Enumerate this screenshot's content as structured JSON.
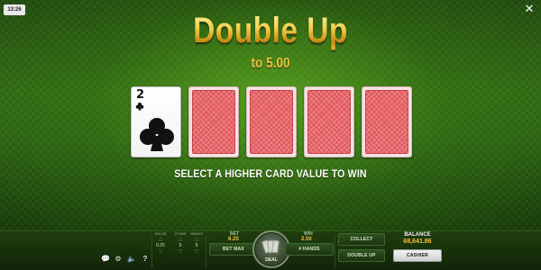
{
  "status": {
    "clock": "13:26"
  },
  "header": {
    "title": "Double Up",
    "subtitle": "to 5.00"
  },
  "cards": {
    "dealer": {
      "rank": "2",
      "suit": "clubs"
    },
    "hidden_count": 4,
    "back_color": "#e35a5e"
  },
  "instruction": "SELECT A HIGHER CARD VALUE TO WIN",
  "icons": {
    "close": "close-icon",
    "chat": "chat-icon",
    "settings": "gear-icon",
    "sound": "speaker-icon",
    "help": "help-icon"
  },
  "bottom": {
    "value": {
      "label": "VALUE",
      "amount": "0.25"
    },
    "coins": {
      "label": "COINS",
      "amount": "5"
    },
    "hands": {
      "label": "HANDS",
      "amount": "5"
    },
    "bet": {
      "label": "BET",
      "amount": "6.25"
    },
    "win": {
      "label": "WIN",
      "amount": "2.50"
    },
    "buttons": {
      "bet_max": "BET MAX",
      "hands": "# HANDS",
      "deal": "DEAL",
      "collect": "COLLECT",
      "double_up": "DOUBLE UP",
      "cashier": "CASHIER"
    },
    "balance": {
      "label": "BALANCE",
      "amount": "68,641.86"
    }
  },
  "colors": {
    "accent_gold": "#f0c33a",
    "felt_green": "#2e6a10"
  }
}
